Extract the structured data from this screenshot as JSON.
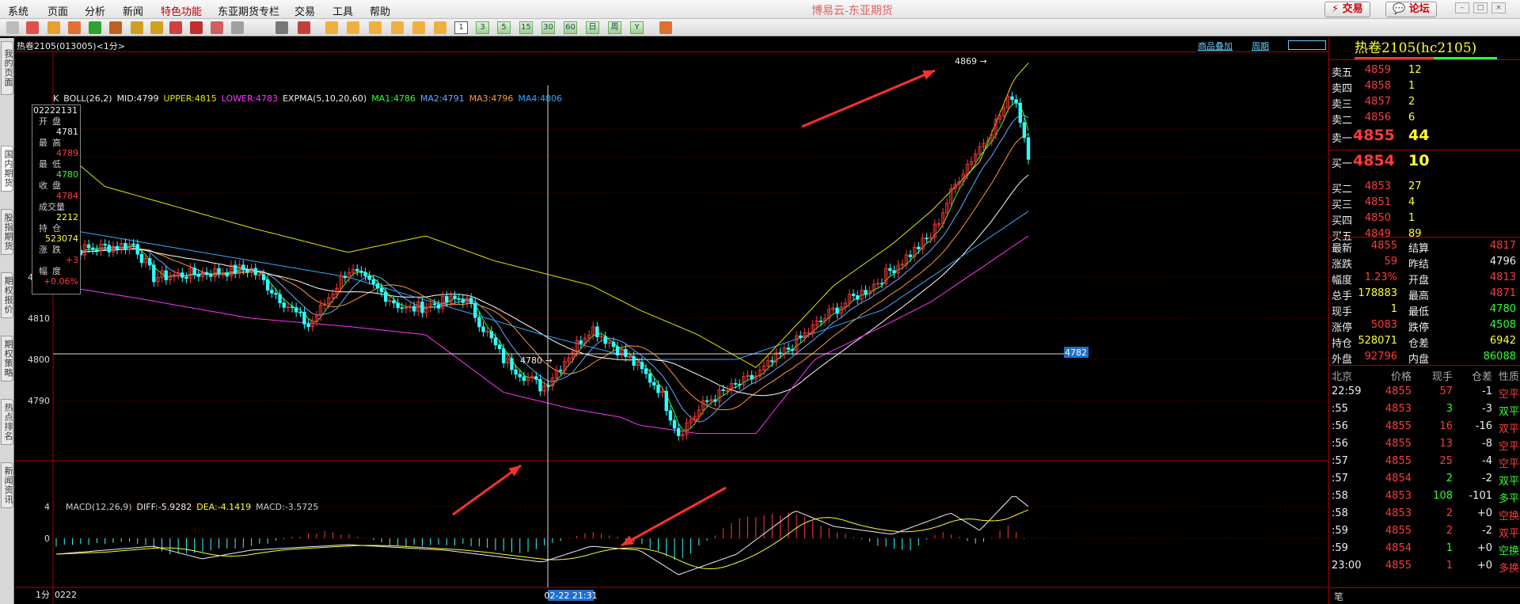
{
  "menu": [
    "系统",
    "页面",
    "分析",
    "新闻",
    "特色功能",
    "东亚期货专栏",
    "交易",
    "工具",
    "帮助"
  ],
  "app_title": "博易云-东亚期货",
  "top_buttons": {
    "trade": "交易",
    "forum": "论坛"
  },
  "toolbar_numbers": [
    "1",
    "3",
    "5",
    "15",
    "30",
    "60",
    "日",
    "周",
    "Y"
  ],
  "side_tabs": [
    "我的页面",
    "国内期货",
    "股指期货",
    "期权报价",
    "期权策略",
    "热点排名",
    "新闻资讯"
  ],
  "chart": {
    "header": "热卷2105(013005)<1分>",
    "links": [
      "商品叠加",
      "周期"
    ],
    "boll_legend": [
      {
        "text": "K",
        "color": "#eee"
      },
      {
        "text": "BOLL(26,2)",
        "color": "#eee"
      },
      {
        "text": "MID:4799",
        "color": "#eee"
      },
      {
        "text": "UPPER:4815",
        "color": "#e6e600"
      },
      {
        "text": "LOWER:4783",
        "color": "#ff33ff"
      },
      {
        "text": "EXPMA(5,10,20,60)",
        "color": "#eee"
      },
      {
        "text": "MA1:4786",
        "color": "#33ff33"
      },
      {
        "text": "MA2:4791",
        "color": "#66aaff"
      },
      {
        "text": "MA3:4796",
        "color": "#ff9933"
      },
      {
        "text": "MA4:4806",
        "color": "#33aaff"
      }
    ],
    "macd_legend": [
      {
        "text": "MACD(12,26,9)",
        "color": "#ccc"
      },
      {
        "text": "DIFF:-5.9282",
        "color": "#eee"
      },
      {
        "text": "DEA:-4.1419",
        "color": "#ffff33"
      },
      {
        "text": "MACD:-3.5725",
        "color": "#ccc"
      }
    ],
    "price_ticks": [
      "4820",
      "4810",
      "4800",
      "4790"
    ],
    "macd_ticks": [
      "4",
      "0"
    ],
    "annotations": {
      "high": "4869",
      "low": "4780",
      "crosshair_price": "4782",
      "crosshair_time": "02-22 21:31",
      "period": "1分",
      "start_date": "0222"
    },
    "info": {
      "date": "02222131",
      "open_label": "开盘",
      "open": "4781",
      "high_label": "最高",
      "high": "4789",
      "low_label": "最低",
      "low": "4780",
      "close_label": "收盘",
      "close": "4784",
      "vol_label": "成交量",
      "vol": "2212",
      "oi_label": "持仓",
      "oi": "523074",
      "chg_label": "涨跌",
      "chg": "+3",
      "pct_label": "幅度",
      "pct": "+0.06%"
    }
  },
  "chart_data": {
    "type": "line",
    "price_axis": [
      4790,
      4800,
      4810,
      4820
    ],
    "macd_axis": [
      0,
      4
    ],
    "series": [
      {
        "name": "MID",
        "last": 4799
      },
      {
        "name": "UPPER",
        "last": 4815
      },
      {
        "name": "LOWER",
        "last": 4783
      },
      {
        "name": "MA1",
        "last": 4786
      },
      {
        "name": "MA2",
        "last": 4791
      },
      {
        "name": "MA3",
        "last": 4796
      },
      {
        "name": "MA4",
        "last": 4806
      },
      {
        "name": "DIFF",
        "last": -5.9282
      },
      {
        "name": "DEA",
        "last": -4.1419
      },
      {
        "name": "MACD",
        "last": -3.5725
      }
    ]
  },
  "quote": {
    "title": "热卷2105(hc2105)",
    "asks": [
      {
        "label": "卖五",
        "price": "4859",
        "vol": "12"
      },
      {
        "label": "卖四",
        "price": "4858",
        "vol": "1"
      },
      {
        "label": "卖三",
        "price": "4857",
        "vol": "2"
      },
      {
        "label": "卖二",
        "price": "4856",
        "vol": "6"
      },
      {
        "label": "卖一",
        "price": "4855",
        "vol": "44"
      }
    ],
    "bids": [
      {
        "label": "买一",
        "price": "4854",
        "vol": "10"
      },
      {
        "label": "买二",
        "price": "4853",
        "vol": "27"
      },
      {
        "label": "买三",
        "price": "4851",
        "vol": "4"
      },
      {
        "label": "买四",
        "price": "4850",
        "vol": "1"
      },
      {
        "label": "买五",
        "price": "4849",
        "vol": "89"
      }
    ],
    "stats": [
      {
        "l1": "最新",
        "v1": "4855",
        "c1": "red",
        "l2": "结算",
        "v2": "4817",
        "c2": "red"
      },
      {
        "l1": "涨跌",
        "v1": "59",
        "c1": "red",
        "l2": "昨结",
        "v2": "4796",
        "c2": "white"
      },
      {
        "l1": "幅度",
        "v1": "1.23%",
        "c1": "red",
        "l2": "开盘",
        "v2": "4813",
        "c2": "red"
      },
      {
        "l1": "总手",
        "v1": "178883",
        "c1": "yellow",
        "l2": "最高",
        "v2": "4871",
        "c2": "red"
      },
      {
        "l1": "现手",
        "v1": "1",
        "c1": "yellow",
        "l2": "最低",
        "v2": "4780",
        "c2": "green"
      },
      {
        "l1": "涨停",
        "v1": "5083",
        "c1": "red",
        "l2": "跌停",
        "v2": "4508",
        "c2": "green"
      },
      {
        "l1": "持仓",
        "v1": "528071",
        "c1": "yellow",
        "l2": "仓差",
        "v2": "6942",
        "c2": "yellow"
      },
      {
        "l1": "外盘",
        "v1": "92796",
        "c1": "red",
        "l2": "内盘",
        "v2": "86088",
        "c2": "green"
      }
    ],
    "ticks_header": [
      "北京",
      "价格",
      "现手",
      "仓差",
      "性质"
    ],
    "ticks": [
      {
        "t": "22:59",
        "p": "4855",
        "v": "57",
        "d": "-1",
        "n": "空平",
        "nc": "red"
      },
      {
        "t": ":55",
        "p": "4853",
        "v": "3",
        "d": "-3",
        "n": "双平",
        "nc": "green"
      },
      {
        "t": ":56",
        "p": "4855",
        "v": "16",
        "d": "-16",
        "n": "双平",
        "nc": "red"
      },
      {
        "t": ":56",
        "p": "4855",
        "v": "13",
        "d": "-8",
        "n": "空平",
        "nc": "red"
      },
      {
        "t": ":57",
        "p": "4855",
        "v": "25",
        "d": "-4",
        "n": "空平",
        "nc": "red"
      },
      {
        "t": ":57",
        "p": "4854",
        "v": "2",
        "d": "-2",
        "n": "双平",
        "nc": "green"
      },
      {
        "t": ":58",
        "p": "4853",
        "v": "108",
        "d": "-101",
        "n": "多平",
        "nc": "green"
      },
      {
        "t": ":58",
        "p": "4853",
        "v": "2",
        "d": "+0",
        "n": "空换",
        "nc": "red"
      },
      {
        "t": ":59",
        "p": "4855",
        "v": "2",
        "d": "-2",
        "n": "双平",
        "nc": "red"
      },
      {
        "t": ":59",
        "p": "4854",
        "v": "1",
        "d": "+0",
        "n": "空换",
        "nc": "green"
      },
      {
        "t": "23:00",
        "p": "4855",
        "v": "1",
        "d": "+0",
        "n": "多换",
        "nc": "red"
      }
    ],
    "footer": "笔"
  }
}
